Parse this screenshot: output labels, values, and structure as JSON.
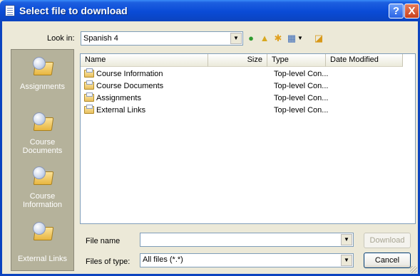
{
  "window": {
    "title": "Select file to download",
    "help_label": "?",
    "close_label": "X"
  },
  "lookin": {
    "label": "Look in:",
    "value": "Spanish 4"
  },
  "toolbar": {
    "icons": [
      "back-icon",
      "up-folder-icon",
      "new-folder-icon",
      "views-menu-icon",
      "extra-icon"
    ]
  },
  "places": [
    {
      "label": "Assignments"
    },
    {
      "label": "Course Documents"
    },
    {
      "label": "Course Information"
    },
    {
      "label": "External Links"
    }
  ],
  "list": {
    "columns": {
      "name": "Name",
      "size": "Size",
      "type": "Type",
      "date": "Date Modified"
    },
    "rows": [
      {
        "name": "Course Information",
        "type": "Top-level Con..."
      },
      {
        "name": "Course Documents",
        "type": "Top-level Con..."
      },
      {
        "name": "Assignments",
        "type": "Top-level Con..."
      },
      {
        "name": "External Links",
        "type": "Top-level Con..."
      }
    ]
  },
  "filename": {
    "label": "File name",
    "value": ""
  },
  "filetype": {
    "label": "Files of type:",
    "value": "All files (*.*)"
  },
  "buttons": {
    "download": "Download",
    "cancel": "Cancel"
  },
  "colors": {
    "titlebar": "#0a4bd6",
    "places_bar": "#b5b29b",
    "dialog": "#ece9d8"
  }
}
